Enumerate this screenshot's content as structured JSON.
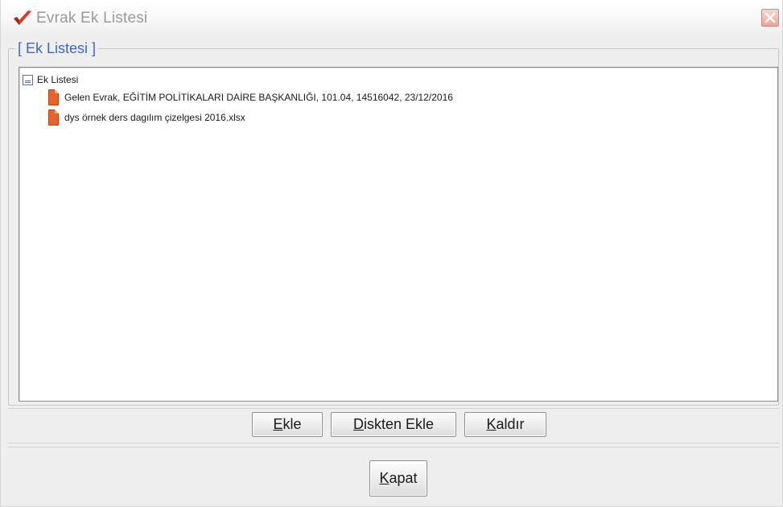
{
  "window": {
    "title": "Evrak Ek Listesi",
    "icons": {
      "app": "app-logo-icon",
      "close": "close-icon"
    }
  },
  "group": {
    "title": "[ Ek Listesi ]"
  },
  "tree": {
    "root_label": "Ek Listesi",
    "root_icon": "tree-root-icon",
    "items": [
      {
        "label": "Gelen Evrak, EĞİTİM POLİTİKALARI DAİRE BAŞKANLIĞI, 101.04, 14516042, 23/12/2016",
        "icon": "document-icon"
      },
      {
        "label": "dys örnek ders dagılım çizelgesi 2016.xlsx",
        "icon": "document-icon"
      }
    ]
  },
  "buttons": {
    "add": {
      "mnemonic": "E",
      "rest": "kle"
    },
    "add_from_disk": {
      "mnemonic": "D",
      "rest": "iskten Ekle"
    },
    "remove": {
      "pre": "",
      "mnemonic": "K",
      "rest": "aldır"
    },
    "close": {
      "mnemonic": "K",
      "rest": "apat"
    }
  },
  "colors": {
    "accent": "#3f67c7",
    "doc_icon": "#e8622a",
    "close_button": "#e7a89b"
  }
}
